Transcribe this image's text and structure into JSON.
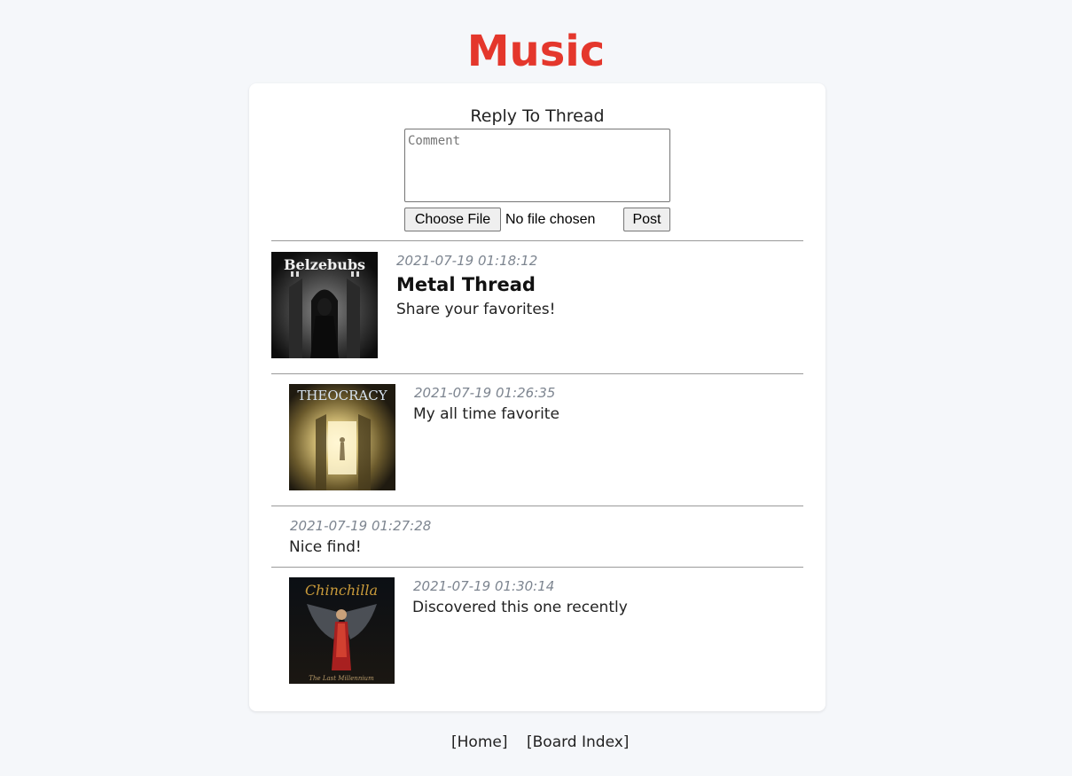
{
  "board": {
    "title": "Music"
  },
  "reply_form": {
    "heading": "Reply To Thread",
    "comment_placeholder": "Comment",
    "comment_value": "",
    "choose_file_label": "Choose File",
    "file_status": "No file chosen",
    "post_label": "Post"
  },
  "thread": {
    "op": {
      "timestamp": "2021-07-19 01:18:12",
      "title": "Metal Thread",
      "message": "Share your favorites!",
      "image_text": "Belzebubs"
    },
    "replies": [
      {
        "timestamp": "2021-07-19 01:26:35",
        "message": "My all time favorite",
        "image_text": "THEOCRACY"
      },
      {
        "timestamp": "2021-07-19 01:27:28",
        "message": "Nice find!"
      },
      {
        "timestamp": "2021-07-19 01:30:14",
        "message": "Discovered this one recently",
        "image_text": "Chinchilla",
        "image_subtext": "The Last Millennium"
      }
    ]
  },
  "footer": {
    "links": [
      {
        "label": "[Home]"
      },
      {
        "label": "[Board Index]"
      }
    ]
  },
  "colors": {
    "title": "#e4372c",
    "page_background": "#f5f7fa",
    "card_background": "#ffffff",
    "timestamp": "#7d8590"
  }
}
